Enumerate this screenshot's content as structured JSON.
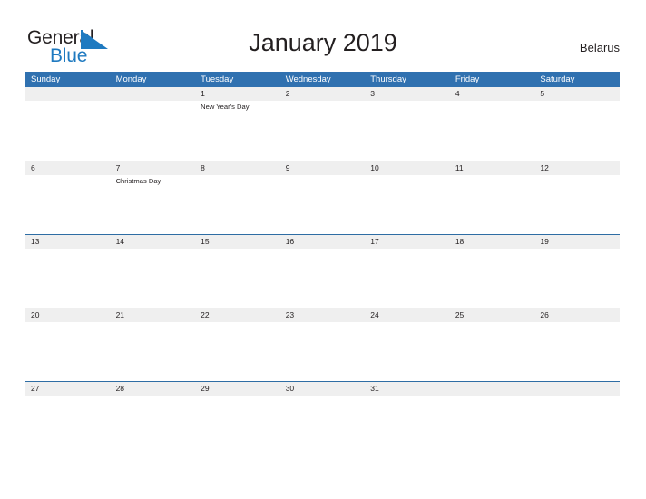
{
  "brand": {
    "name_part1": "General",
    "name_part2": "Blue",
    "triangle_color": "#1f7ac0",
    "text_color": "#231f20"
  },
  "header": {
    "title": "January 2019",
    "country": "Belarus"
  },
  "theme": {
    "header_blue": "#3071b0",
    "row_line_blue": "#2e6da4",
    "band_gray": "#efefef",
    "text_color": "#231f20",
    "header_text_color": "#ffffff",
    "page_background": "#ffffff"
  },
  "calendar": {
    "month": "January",
    "year": "2019",
    "weekday_headers": [
      "Sunday",
      "Monday",
      "Tuesday",
      "Wednesday",
      "Thursday",
      "Friday",
      "Saturday"
    ],
    "weeks": [
      [
        {
          "day": "",
          "events": []
        },
        {
          "day": "",
          "events": []
        },
        {
          "day": "1",
          "events": [
            "New Year's Day"
          ]
        },
        {
          "day": "2",
          "events": []
        },
        {
          "day": "3",
          "events": []
        },
        {
          "day": "4",
          "events": []
        },
        {
          "day": "5",
          "events": []
        }
      ],
      [
        {
          "day": "6",
          "events": []
        },
        {
          "day": "7",
          "events": [
            "Christmas Day"
          ]
        },
        {
          "day": "8",
          "events": []
        },
        {
          "day": "9",
          "events": []
        },
        {
          "day": "10",
          "events": []
        },
        {
          "day": "11",
          "events": []
        },
        {
          "day": "12",
          "events": []
        }
      ],
      [
        {
          "day": "13",
          "events": []
        },
        {
          "day": "14",
          "events": []
        },
        {
          "day": "15",
          "events": []
        },
        {
          "day": "16",
          "events": []
        },
        {
          "day": "17",
          "events": []
        },
        {
          "day": "18",
          "events": []
        },
        {
          "day": "19",
          "events": []
        }
      ],
      [
        {
          "day": "20",
          "events": []
        },
        {
          "day": "21",
          "events": []
        },
        {
          "day": "22",
          "events": []
        },
        {
          "day": "23",
          "events": []
        },
        {
          "day": "24",
          "events": []
        },
        {
          "day": "25",
          "events": []
        },
        {
          "day": "26",
          "events": []
        }
      ],
      [
        {
          "day": "27",
          "events": []
        },
        {
          "day": "28",
          "events": []
        },
        {
          "day": "29",
          "events": []
        },
        {
          "day": "30",
          "events": []
        },
        {
          "day": "31",
          "events": []
        },
        {
          "day": "",
          "events": []
        },
        {
          "day": "",
          "events": []
        }
      ]
    ]
  }
}
